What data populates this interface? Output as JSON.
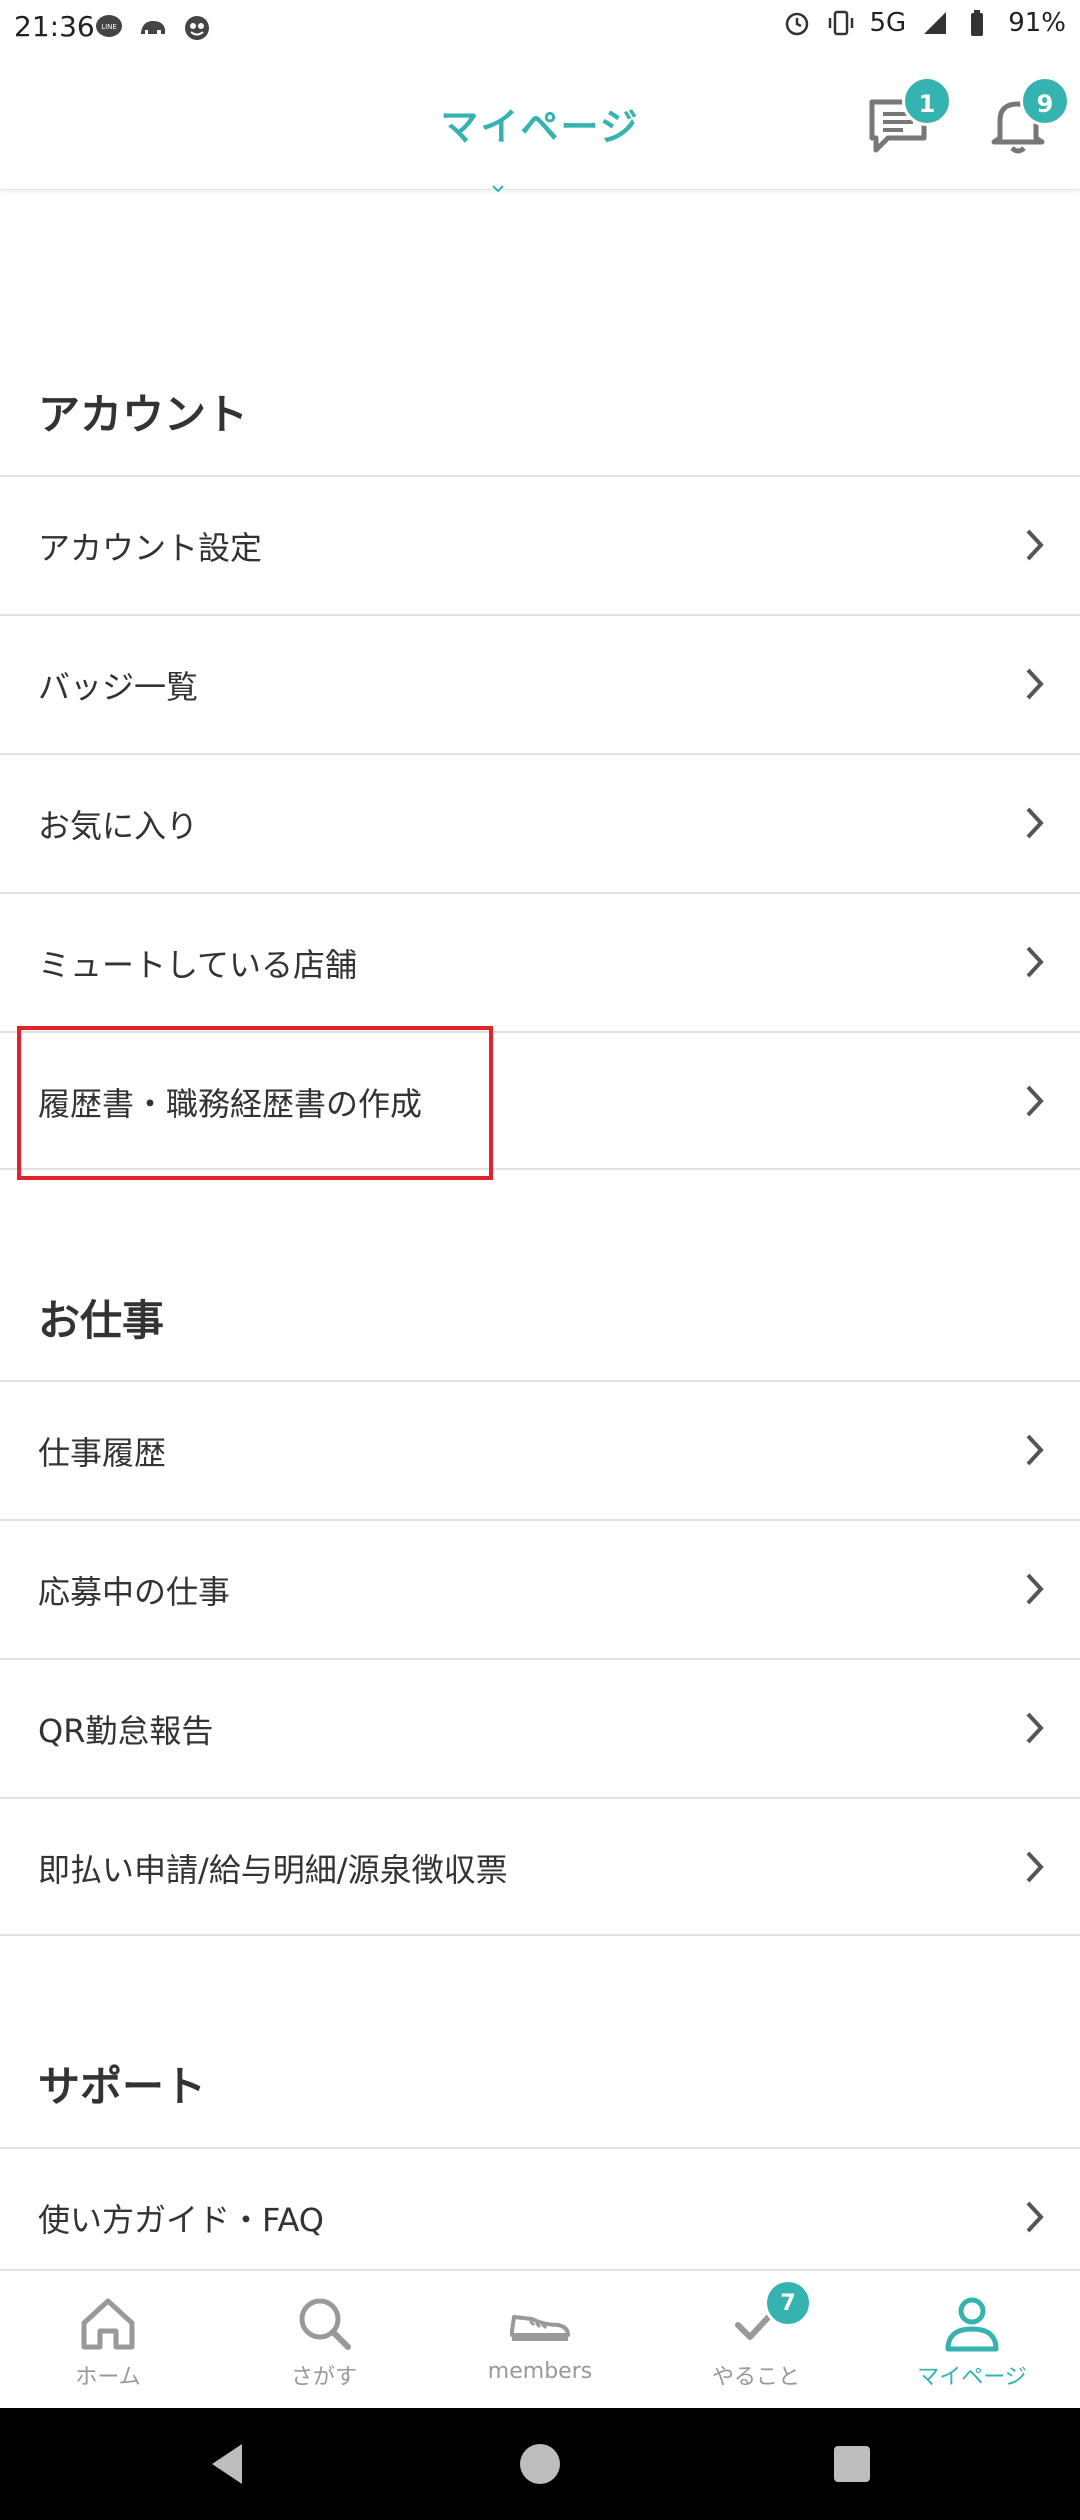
{
  "status_bar": {
    "time": "21:36",
    "network": "5G",
    "battery": "91%",
    "left_icons": [
      "line-icon",
      "animal-app-icon",
      "character-app-icon"
    ],
    "right_icons": [
      "alarm-icon",
      "vibrate-icon",
      "signal-icon",
      "battery-icon"
    ]
  },
  "header": {
    "title": "マイページ",
    "messages_badge": "1",
    "notifications_badge": "9",
    "accent_color": "#35b3b0"
  },
  "sections": [
    {
      "title": "アカウント",
      "items": [
        {
          "label": "アカウント設定"
        },
        {
          "label": "バッジ一覧"
        },
        {
          "label": "お気に入り"
        },
        {
          "label": "ミュートしている店舗"
        },
        {
          "label": "履歴書・職務経歴書の作成",
          "highlighted": true
        }
      ]
    },
    {
      "title": "お仕事",
      "items": [
        {
          "label": "仕事履歴"
        },
        {
          "label": "応募中の仕事"
        },
        {
          "label": "QR勤怠報告"
        },
        {
          "label": "即払い申請/給与明細/源泉徴収票"
        }
      ]
    },
    {
      "title": "サポート",
      "items": [
        {
          "label": "使い方ガイド・FAQ"
        }
      ]
    }
  ],
  "tab_bar": {
    "tabs": [
      {
        "label": "ホーム",
        "icon": "home-icon"
      },
      {
        "label": "さがす",
        "icon": "search-icon"
      },
      {
        "label": "members",
        "icon": "shoe-icon"
      },
      {
        "label": "やること",
        "icon": "check-icon",
        "badge": "7"
      },
      {
        "label": "マイページ",
        "icon": "person-icon",
        "active": true
      }
    ]
  },
  "highlight_color": "#e3222a"
}
